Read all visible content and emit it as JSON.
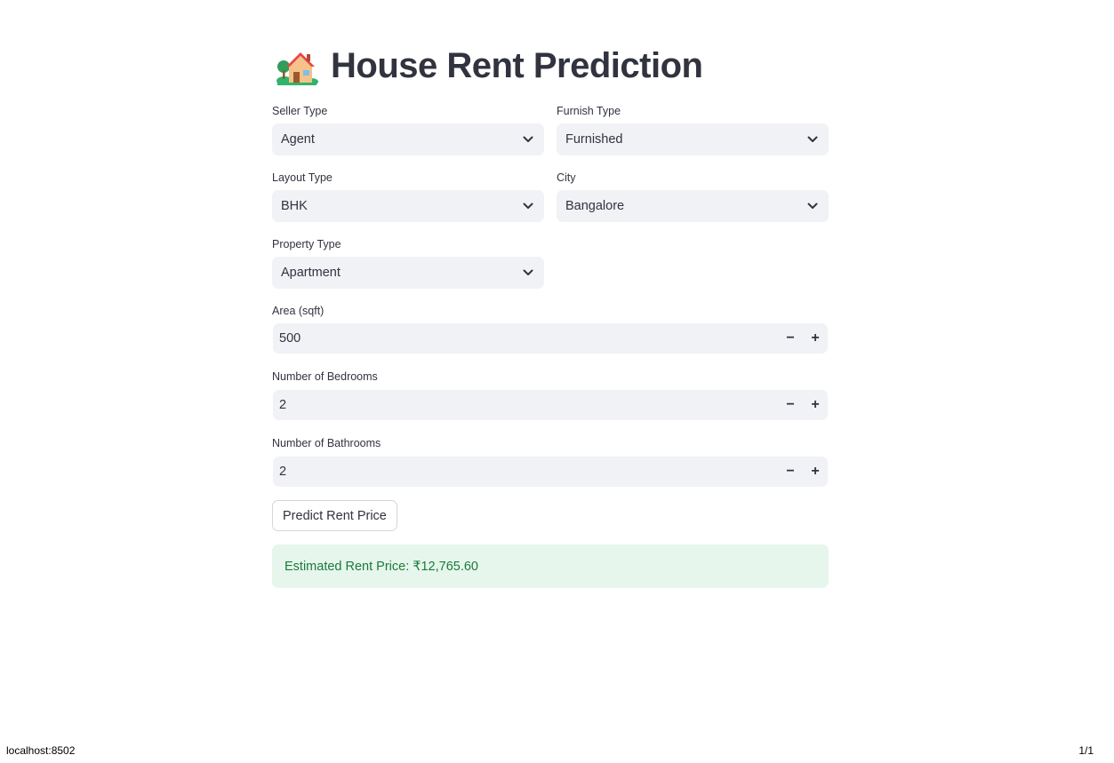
{
  "app": {
    "title": "House Rent Prediction",
    "title_icon": "house-with-garden-icon"
  },
  "form": {
    "seller_type": {
      "label": "Seller Type",
      "value": "Agent"
    },
    "furnish_type": {
      "label": "Furnish Type",
      "value": "Furnished"
    },
    "layout_type": {
      "label": "Layout Type",
      "value": "BHK"
    },
    "city": {
      "label": "City",
      "value": "Bangalore"
    },
    "property_type": {
      "label": "Property Type",
      "value": "Apartment"
    },
    "area": {
      "label": "Area (sqft)",
      "value": "500"
    },
    "bedrooms": {
      "label": "Number of Bedrooms",
      "value": "2"
    },
    "bathrooms": {
      "label": "Number of Bathrooms",
      "value": "2"
    },
    "minus_label": "−",
    "plus_label": "+",
    "predict_button": "Predict Rent Price"
  },
  "result": {
    "text": "Estimated Rent Price: ₹12,765.60"
  },
  "status_bar": {
    "url": "localhost:8502",
    "page": "1/1"
  },
  "colors": {
    "input_bg": "#f0f2f6",
    "success_bg": "#e6f6ec",
    "success_text": "#1b7a3a",
    "text": "#31333f"
  }
}
